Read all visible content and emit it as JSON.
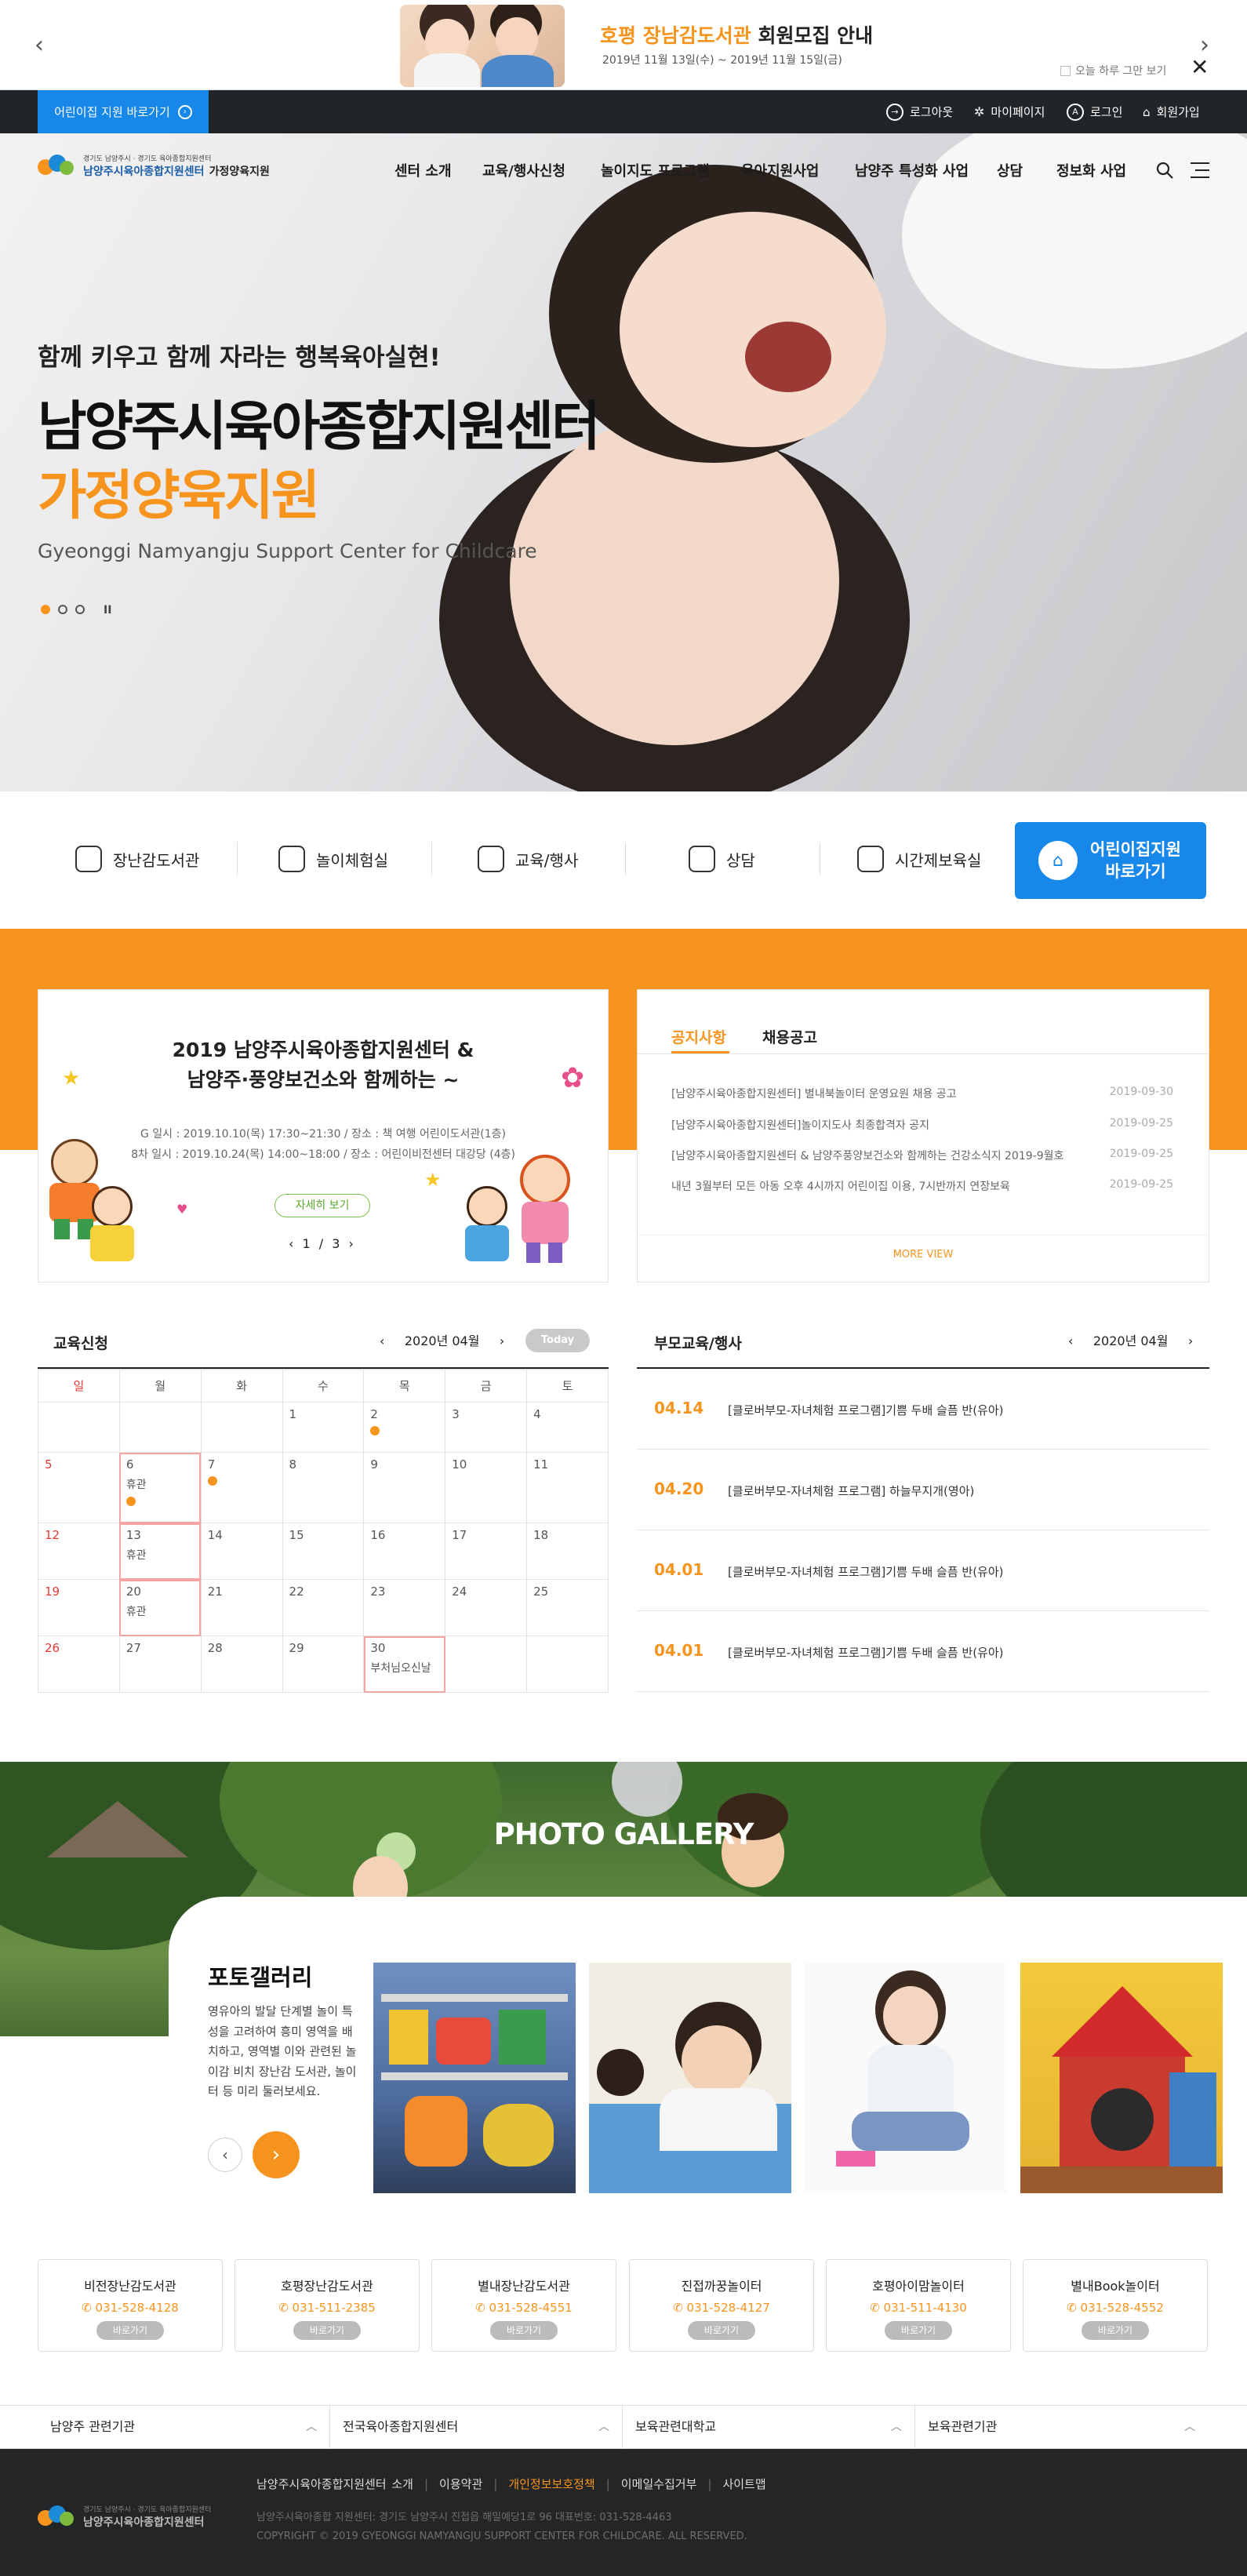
{
  "popup": {
    "title_highlight": "호평 장남감도서관",
    "title_rest": "회원모집 안내",
    "dates": "2019년 11월 13일(수) ~ 2019년 11월 15일(금)",
    "dismiss_label": "오늘 하루 그만 보기"
  },
  "topbar": {
    "daycare_link": "어린이집 지원 바로가기",
    "utils": [
      "로그아웃",
      "마이페이지",
      "로그인",
      "회원가입"
    ]
  },
  "logo": {
    "small": "경기도 남양주시 · 경기도 육아종합지원센터",
    "main": "남양주시육아종합지원센터",
    "sub": "가정양육지원"
  },
  "nav": [
    "센터 소개",
    "교육/행사신청",
    "놀이지도 프로그램",
    "육아지원사업",
    "남양주 특성화 사업",
    "상담",
    "정보화 사업"
  ],
  "hero": {
    "subtitle": "함께 키우고 함께 자라는 행복육아실현!",
    "title": "남양주시육아종합지원센터",
    "title_accent": "가정양육지원",
    "english": "Gyeonggi Namyangju Support Center for Childcare",
    "pause": "II"
  },
  "quick": [
    "장난감도서관",
    "놀이체험실",
    "교육/행사",
    "상담",
    "시간제보육실"
  ],
  "daycare_button": {
    "line1": "어린이집지원",
    "line2": "바로가기"
  },
  "event": {
    "title_line1": "2019 남양주시육아종합지원센터 &",
    "title_line2": "남양주·풍양보건소와 함께하는 ~",
    "detail1": "G 일시 : 2019.10.10(목) 17:30~21:30 / 장소 : 책 여행 어린이도서관(1층)",
    "detail2": "8차 일시 : 2019.10.24(목) 14:00~18:00 / 장소 : 어린이비전센터 대강당 (4층)",
    "detail_button": "자세히 보기",
    "pager": "‹ 1 / 3 ›"
  },
  "notice": {
    "tab_active": "공지사항",
    "tab_other": "채용공고",
    "rows": [
      {
        "text": "[남양주시육아종합지원센터] 별내북놀이터 운영요원 채용 공고",
        "date": "2019-09-30"
      },
      {
        "text": "[남양주시육아종합지원센터]놀이지도사 최종합격자 공지",
        "date": "2019-09-25"
      },
      {
        "text": "[남양주시육아종합지원센터 & 남양주풍양보건소와 함께하는 건강소식지 2019-9월호",
        "date": "2019-09-25"
      },
      {
        "text": "내년 3월부터 모든 아동 오후 4시까지 어린이집 이용, 7시반까지 연장보육",
        "date": "2019-09-25"
      }
    ],
    "more": "MORE VIEW"
  },
  "calendar": {
    "title": "교육신청",
    "month": "2020년 04월",
    "today": "Today",
    "weekdays": [
      "일",
      "월",
      "화",
      "수",
      "목",
      "금",
      "토"
    ]
  },
  "parent_edu": {
    "title": "부모교육/행사",
    "month": "2020년 04월",
    "rows": [
      {
        "date": "04.14",
        "text": "[클로버부모-자녀체험 프로그램]기쁨 두배 슬픔 반(유아)"
      },
      {
        "date": "04.20",
        "text": "[클로버부모-자녀체험 프로그램] 하늘무지개(영아)"
      },
      {
        "date": "04.01",
        "text": "[클로버부모-자녀체험 프로그램]기쁨 두배 슬픔 반(유아)"
      },
      {
        "date": "04.01",
        "text": "[클로버부모-자녀체험 프로그램]기쁨 두배 슬픔 반(유아)"
      }
    ]
  },
  "gallery": {
    "heading": "PHOTO GALLERY",
    "title": "포토갤러리",
    "desc": "영유아의 발달 단계별 놀이 특성을 고려하여 흥미 영역을 배치하고, 영역별 이와 관련된 놀이감 비치 장난감 도서관, 놀이터 등 미리 둘러보세요."
  },
  "facilities": [
    {
      "name": "비전장난감도서관",
      "phone": "031-528-4128",
      "btn": "바로가기"
    },
    {
      "name": "호평장난감도서관",
      "phone": "031-511-2385",
      "btn": "바로가기"
    },
    {
      "name": "별내장난감도서관",
      "phone": "031-528-4551",
      "btn": "바로가기"
    },
    {
      "name": "진접까꿍놀이터",
      "phone": "031-528-4127",
      "btn": "바로가기"
    },
    {
      "name": "호평아이맘놀이터",
      "phone": "031-511-4130",
      "btn": "바로가기"
    },
    {
      "name": "별내Book놀이터",
      "phone": "031-528-4552",
      "btn": "바로가기"
    }
  ],
  "related": [
    "남양주 관련기관",
    "전국육아종합지원센터",
    "보육관련대학교",
    "보육관련기관"
  ],
  "footer": {
    "links": [
      "남양주시육아종합지원센터 소개",
      "이용약관",
      "개인정보보호정책",
      "이메일수집거부",
      "사이트맵"
    ],
    "address": "남양주시육아종합 지원센터: 경기도 남양주시 진접읍 해밀예당1로 96     대표번호: 031-528-4463",
    "copyright": "COPYRIGHT © 2019 GYEONGGI NAMYANGJU SUPPORT CENTER FOR CHILDCARE. ALL RESERVED.",
    "logo_main": "남양주시육아종합지원센터",
    "logo_small": "경기도 남양주시 · 경기도 육아종합지원센터"
  },
  "colors": {
    "accent": "#f7941d",
    "primary": "#1787ea",
    "dark": "#222528"
  }
}
